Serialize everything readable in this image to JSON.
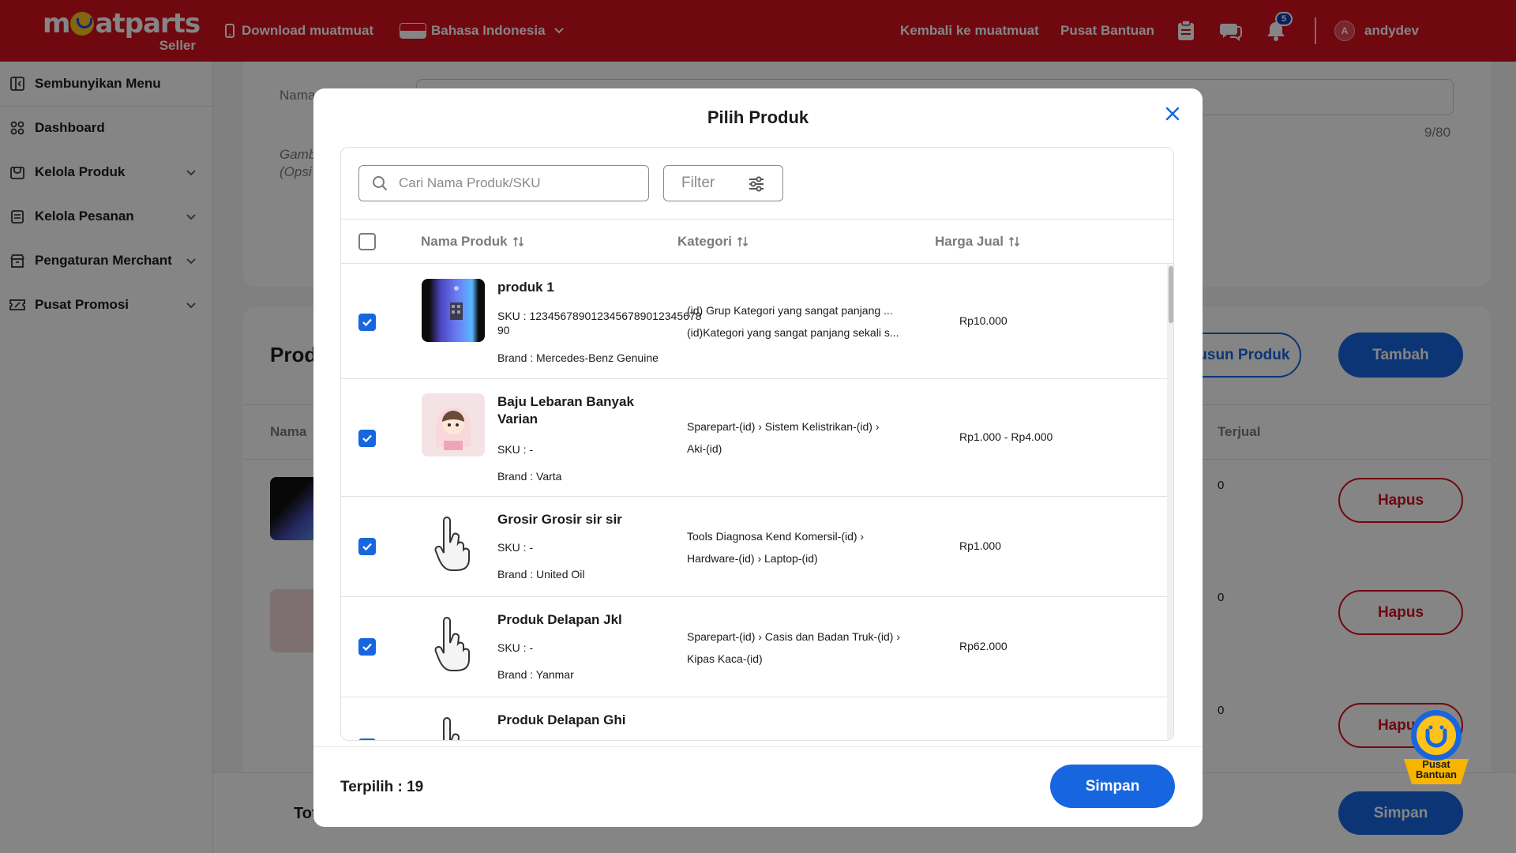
{
  "topbar": {
    "logo_text": "muatparts",
    "logo_sub": "Seller",
    "download": "Download muatmuat",
    "language": "Bahasa Indonesia",
    "back": "Kembali ke muatmuat",
    "help": "Pusat Bantuan",
    "notif_count": "5",
    "avatar_initial": "A",
    "username": "andydev"
  },
  "sidebar": {
    "items": [
      {
        "label": "Sembunyikan Menu"
      },
      {
        "label": "Dashboard"
      },
      {
        "label": "Kelola Produk"
      },
      {
        "label": "Kelola Pesanan"
      },
      {
        "label": "Pengaturan Merchant"
      },
      {
        "label": "Pusat Promosi"
      }
    ]
  },
  "background": {
    "field_label_nama": "Nama",
    "char_count": "9/80",
    "field_label_gambar": "Gamb",
    "field_label_opsional": "(Opsi",
    "section_title": "Prod",
    "col_nama": "Nama",
    "col_terjual": "Terjual",
    "susun_produk": "Susun Produk",
    "tambah": "Tambah",
    "hapus": "Hapus",
    "terjual_values": [
      "0",
      "0",
      "0"
    ],
    "total_label": "Tot",
    "simpan": "Simpan"
  },
  "modal": {
    "title": "Pilih Produk",
    "search_placeholder": "Cari Nama Produk/SKU",
    "filter_label": "Filter",
    "columns": {
      "name": "Nama Produk",
      "category": "Kategori",
      "price": "Harga Jual"
    },
    "rows": [
      {
        "name": "produk 1",
        "sku": "SKU : 1234567890123456789012345678​90",
        "brand": "Brand : Mercedes-Benz Genuine",
        "category_line1": "(id) Grup Kategori yang sangat panjang ...",
        "category_line2": "(id)Kategori yang sangat panjang sekali s...",
        "price": "Rp10.000",
        "checked": true
      },
      {
        "name": "Baju Lebaran Banyak Varian",
        "sku": "SKU : -",
        "brand": "Brand : Varta",
        "category_line1": "Sparepart-(id) › Sistem Kelistrikan-(id) ›",
        "category_line2": "Aki-(id)",
        "price": "Rp1.000 - Rp4.000",
        "checked": true
      },
      {
        "name": "Grosir Grosir sir sir",
        "sku": "SKU : -",
        "brand": "Brand : United Oil",
        "category_line1": "Tools Diagnosa Kend Komersil-(id) ›",
        "category_line2": "Hardware-(id) › Laptop-(id)",
        "price": "Rp1.000",
        "checked": true
      },
      {
        "name": "Produk Delapan Jkl",
        "sku": "SKU : -",
        "brand": "Brand : Yanmar",
        "category_line1": "Sparepart-(id) › Casis dan Badan Truk-(id) ›",
        "category_line2": "Kipas Kaca-(id)",
        "price": "Rp62.000",
        "checked": true
      },
      {
        "name": "Produk Delapan Ghi",
        "sku": "",
        "brand": "",
        "category_line1": "",
        "category_line2": "",
        "price": "",
        "checked": true
      }
    ],
    "selected_label": "Terpilih : 19",
    "save_label": "Simpan"
  },
  "help_widget": {
    "line1": "Pusat",
    "line2": "Bantuan"
  },
  "colors": {
    "brand_red": "#d7101f",
    "primary_blue": "#1766e0",
    "accent_yellow": "#ffc21a"
  }
}
